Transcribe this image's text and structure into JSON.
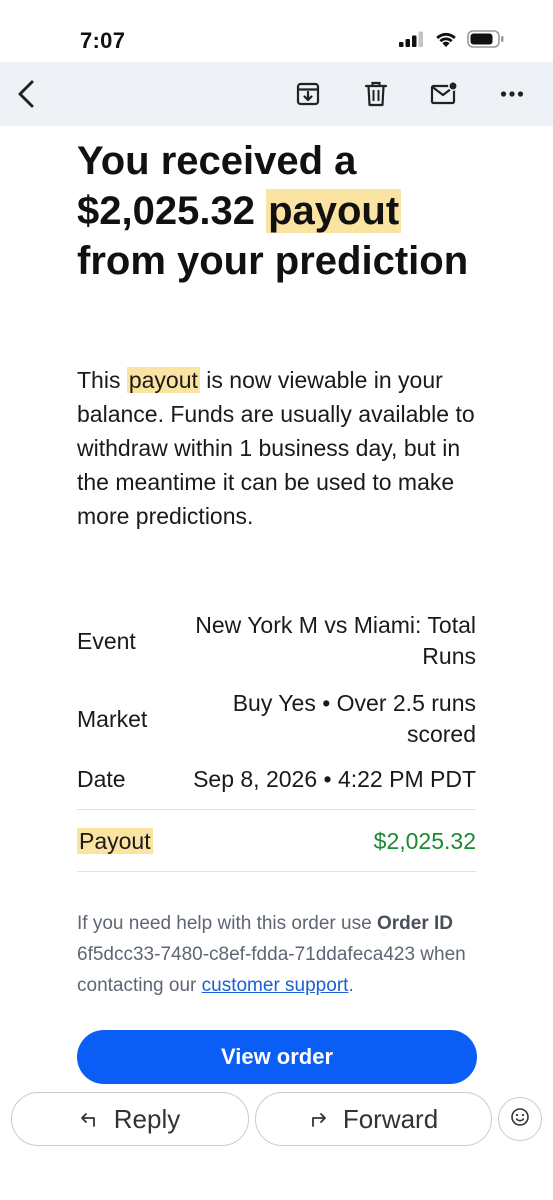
{
  "status_bar": {
    "time": "7:07",
    "icons": [
      "cellular-signal-icon",
      "wifi-icon",
      "battery-icon"
    ]
  },
  "toolbar": {
    "icons": [
      "back-arrow-icon",
      "archive-icon",
      "trash-icon",
      "mark-unread-icon",
      "more-icon"
    ]
  },
  "email": {
    "title_part1": "You received a $2,025.32 ",
    "title_highlight": "payout",
    "title_part2": " from your prediction",
    "body_part1": "This ",
    "body_highlight": "payout",
    "body_part2": " is now viewable in your balance. Funds are usually available to withdraw within 1 business day, but in the meantime it can be used to make more predictions.",
    "details": {
      "event_label": "Event",
      "event_value": "New York M vs Miami: Total Runs",
      "market_label": "Market",
      "market_value": "Buy Yes • Over 2.5 runs scored",
      "date_label": "Date",
      "date_value": "Sep 8, 2026 • 4:22 PM PDT",
      "payout_label": "Payout",
      "payout_value": "$2,025.32"
    },
    "help_part1": "If you need help with this order use ",
    "help_bold": "Order ID",
    "help_order_id": " 6f5dcc33-7480-c8ef-fdda-71ddafeca423",
    "help_part2": " when contacting our ",
    "help_link": "customer support",
    "help_end": ".",
    "view_order_label": "View order"
  },
  "bottom_bar": {
    "reply_label": "Reply",
    "forward_label": "Forward"
  },
  "colors": {
    "highlight": "#fbe3a2",
    "primary_button": "#0a5ef5",
    "payout_green": "#1a8a2e",
    "link_blue": "#1a5fd6",
    "toolbar_bg": "#eef1f6"
  }
}
